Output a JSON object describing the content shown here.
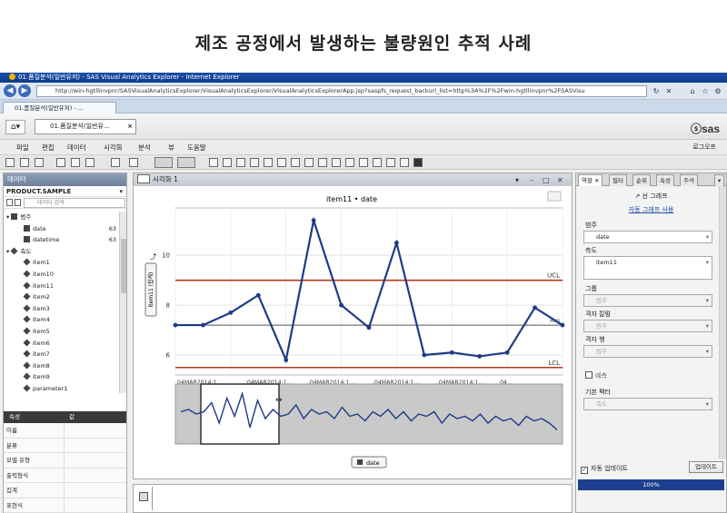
{
  "page_title": "제조 공정에서 발생하는 불량원인 추적 사례",
  "browser": {
    "window_title": "01.품질분석(일반유저) - SAS Visual Analytics Explorer - Internet Explorer",
    "url": "http://win-hgtllinvpnr/SASVisualAnalyticsExplorer/VisualAnalyticsExplorer/VisualAnalyticsExplorerApp.jsp?saspfs_request_backurl_list=http%3A%2F%2Fwin-hgtllinvpnr%2FSASVisu",
    "tab_label": "01.품질분석(일반유저) - ..."
  },
  "app": {
    "tab_label": "01.품질분석(일반유...",
    "tab_close": "×",
    "logo": "ⓢsas",
    "menu": [
      "파일",
      "편집",
      "데이터",
      "시각화",
      "분석",
      "뷰",
      "도움말"
    ],
    "logout": "로그오프"
  },
  "data_panel": {
    "title": "데이터",
    "dataset": "PRODUCT.SAMPLE",
    "search_placeholder": "데이터 검색",
    "category_header": "범주",
    "categories": [
      {
        "name": "date",
        "count": "63"
      },
      {
        "name": "datetime",
        "count": "63"
      }
    ],
    "measure_header": "측도",
    "measures": [
      "item1",
      "item10",
      "item11",
      "item2",
      "item3",
      "item4",
      "item5",
      "item6",
      "item7",
      "item8",
      "item9",
      "parameter1"
    ],
    "properties_header": [
      "속성",
      "값"
    ],
    "properties": [
      "이름",
      "분류",
      "모델 유형",
      "출력형식",
      "집계",
      "표현식"
    ]
  },
  "viz": {
    "tab_title": "시각화 1",
    "chart_title": "item11 • date",
    "y_axis_label": "item11 (합계)",
    "x_axis_button": "date",
    "ucl_label": "UCL",
    "lcl_label": "LCL",
    "avg_label": "Avg",
    "x_tick_labels_top": [
      "04MAR2014:1...",
      "..:04MAR2014:1...",
      "..04MAR2014:1...",
      "..04MAR2014:1...",
      "..04MAR2014:1...",
      "04..."
    ],
    "x_tick_labels_bottom": [
      "04MAR2014:1...",
      "04MAR2014:1...",
      "04MAR2014:1...",
      "04MAR2014:1...",
      "04MAR2014:1..."
    ]
  },
  "chart_data": {
    "type": "line",
    "title": "item11 • date",
    "ylabel": "item11 (합계)",
    "xlabel": "date",
    "y_ticks": [
      6,
      8,
      10
    ],
    "ylim": [
      5.2,
      11.9
    ],
    "values": [
      7.2,
      7.2,
      7.7,
      8.4,
      5.8,
      11.4,
      8.0,
      7.1,
      10.5,
      6.0,
      6.1,
      5.95,
      6.1,
      7.9,
      7.2
    ],
    "ucl": 9.0,
    "lcl": 5.5,
    "average": 7.2,
    "overview_values": [
      0.55,
      0.6,
      0.5,
      0.55,
      0.75,
      0.3,
      0.85,
      0.45,
      0.95,
      0.2,
      0.8,
      0.4,
      0.6,
      0.45,
      0.5,
      0.7,
      0.4,
      0.6,
      0.5,
      0.55,
      0.4,
      0.65,
      0.45,
      0.5,
      0.35,
      0.55,
      0.45,
      0.6,
      0.4,
      0.55,
      0.35,
      0.5,
      0.45,
      0.55,
      0.3,
      0.5,
      0.4,
      0.45,
      0.35,
      0.5,
      0.3,
      0.45,
      0.35,
      0.4,
      0.25,
      0.45,
      0.35,
      0.4,
      0.3,
      0.15
    ],
    "grid": true
  },
  "roles_panel": {
    "tabs": [
      "역할",
      "필터",
      "순위",
      "속성",
      "주석"
    ],
    "chart_type": "선 그래프",
    "auto_chart_link": "자동 그래프 사용",
    "category_label": "범주",
    "category_value": "date",
    "measure_label": "측도",
    "measure_value": "item11",
    "group_label": "그룹",
    "group_value": "범주",
    "lattice_col_label": "격자 칼럼",
    "lattice_col_value": "범주",
    "lattice_row_label": "격자 행",
    "lattice_row_value": "범주",
    "overlay_label": "예측",
    "baseline_label": "기본 팩터",
    "baseline_value": "측도",
    "auto_update_label": "자동 업데이트",
    "update_button": "업데이트",
    "progress": "100%"
  }
}
